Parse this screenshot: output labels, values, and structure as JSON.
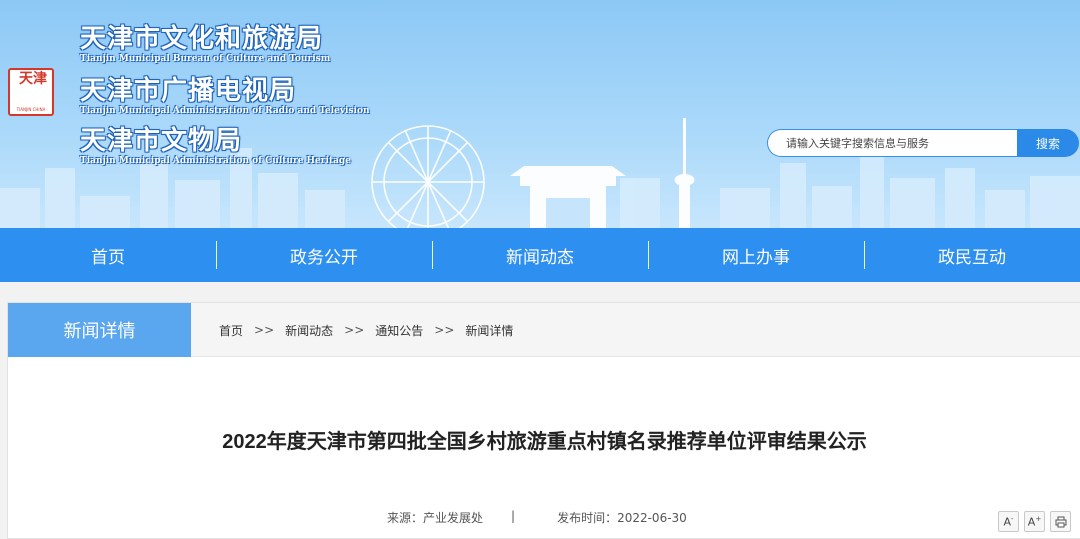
{
  "header": {
    "seal": {
      "text": "天津",
      "sub": "TIANJIN CHINA"
    },
    "orgs": [
      {
        "cn": "天津市文化和旅游局",
        "en": "Tianjin Municipal Bureau of Culture and Tourism"
      },
      {
        "cn": "天津市广播电视局",
        "en": "Tianjin Municipal Administration of Radio and Television"
      },
      {
        "cn": "天津市文物局",
        "en": "Tianjin Municipal Administration of Culture Heritage"
      }
    ],
    "search": {
      "placeholder": "请输入关键字搜索信息与服务",
      "button": "搜索"
    }
  },
  "nav": {
    "items": [
      "首页",
      "政务公开",
      "新闻动态",
      "网上办事",
      "政民互动"
    ]
  },
  "content": {
    "section_tab": "新闻详情",
    "breadcrumb": [
      "首页",
      "新闻动态",
      "通知公告",
      "新闻详情"
    ],
    "breadcrumb_sep": ">>",
    "title": "2022年度天津市第四批全国乡村旅游重点村镇名录推荐单位评审结果公示",
    "source_label": "来源：产业发展处",
    "divider": "|",
    "date_label": "发布时间：2022-06-30",
    "tools": {
      "font_smaller": "A",
      "font_larger": "A",
      "print": "🖶"
    }
  },
  "colors": {
    "nav": "#2d8fef",
    "tab": "#5aa6ef",
    "search_button": "#2b8ae8",
    "seal": "#d3382b"
  }
}
